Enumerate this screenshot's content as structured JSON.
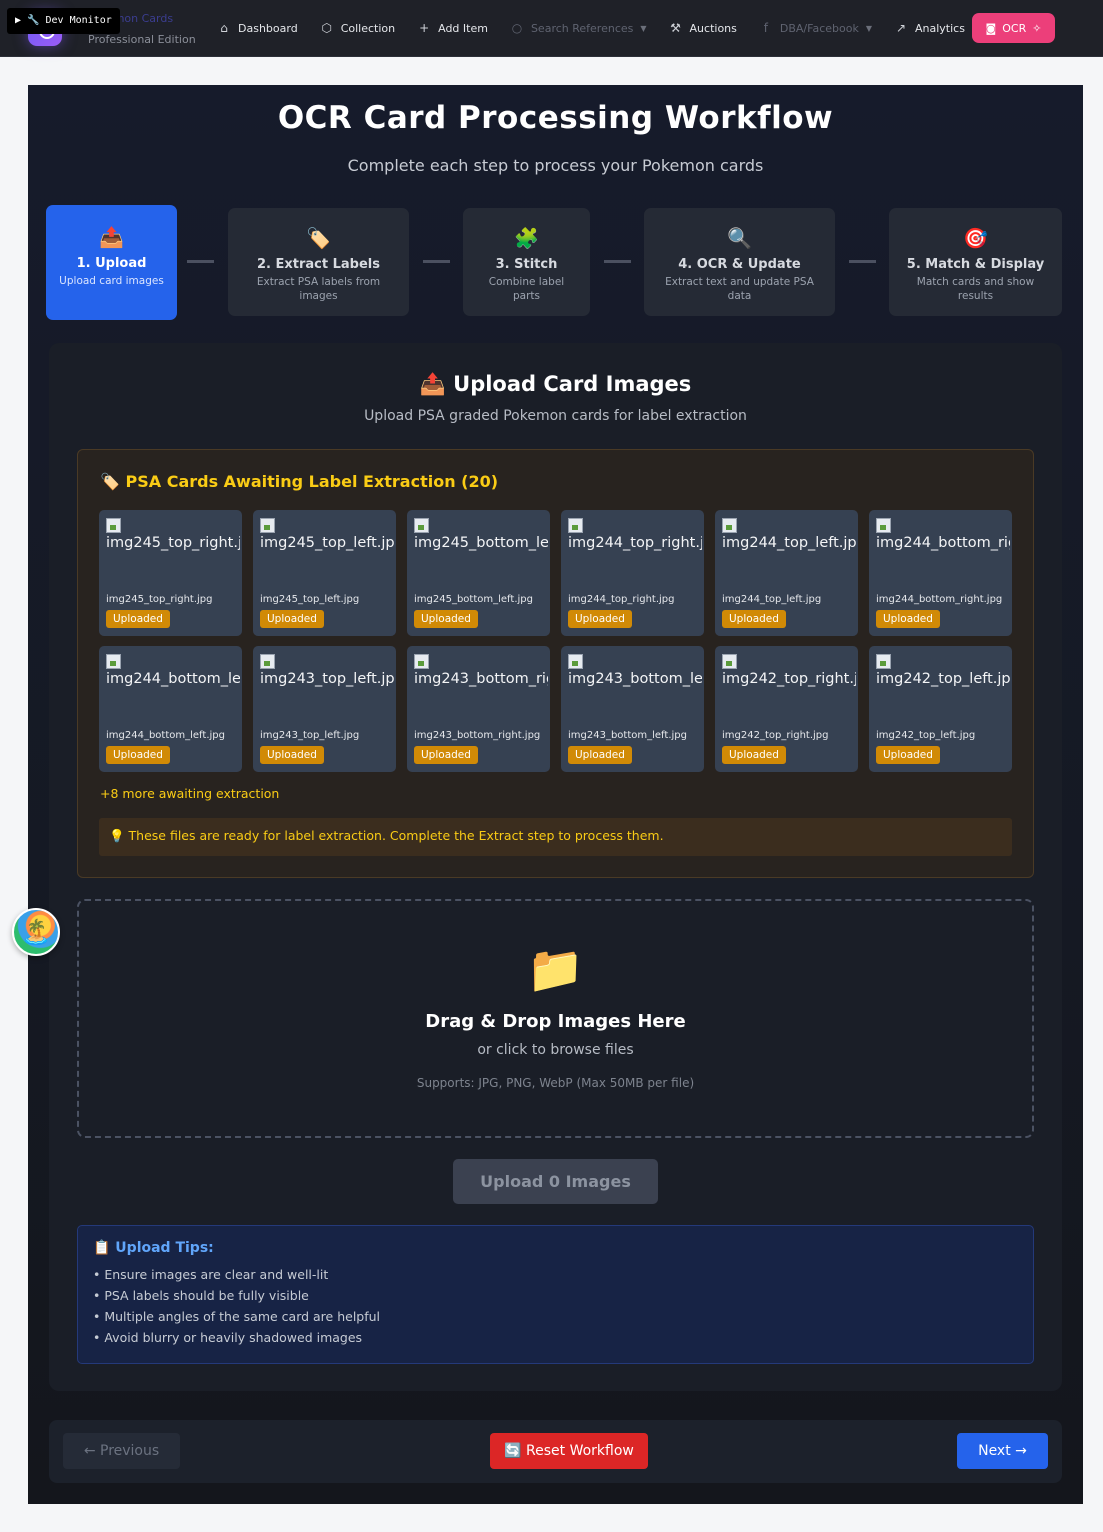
{
  "dev_monitor": "▶ 🔧 Dev Monitor",
  "brand": {
    "name": "Pokemon Cards",
    "edition": "Professional Edition"
  },
  "nav": {
    "items": [
      {
        "label": "Dashboard",
        "icon": "home-icon"
      },
      {
        "label": "Collection",
        "icon": "box-icon"
      },
      {
        "label": "Add Item",
        "icon": "plus-icon"
      },
      {
        "label": "Search References",
        "icon": "search-icon"
      },
      {
        "label": "Auctions",
        "icon": "gavel-icon"
      },
      {
        "label": "DBA/Facebook",
        "icon": "facebook-icon"
      },
      {
        "label": "Analytics",
        "icon": "trend-icon"
      }
    ],
    "ocr": "OCR"
  },
  "page": {
    "title": "OCR Card Processing Workflow",
    "subtitle": "Complete each step to process your Pokemon cards"
  },
  "steps": [
    {
      "icon": "📤",
      "title": "1. Upload",
      "desc": "Upload card images",
      "active": true
    },
    {
      "icon": "🏷️",
      "title": "2. Extract Labels",
      "desc": "Extract PSA labels from images",
      "active": false
    },
    {
      "icon": "🧩",
      "title": "3. Stitch",
      "desc": "Combine label parts",
      "active": false
    },
    {
      "icon": "🔍",
      "title": "4. OCR & Update",
      "desc": "Extract text and update PSA data",
      "active": false
    },
    {
      "icon": "🎯",
      "title": "5. Match & Display",
      "desc": "Match cards and show results",
      "active": false
    }
  ],
  "upload": {
    "title": "📤 Upload Card Images",
    "subtitle": "Upload PSA graded Pokemon cards for label extraction"
  },
  "awaiting": {
    "title": "🏷️ PSA Cards Awaiting Label Extraction (20)",
    "cards": [
      {
        "alt": "img245_top_right.jpg",
        "filename": "img245_top_right.jpg",
        "status": "Uploaded"
      },
      {
        "alt": "img245_top_left.jpg",
        "filename": "img245_top_left.jpg",
        "status": "Uploaded"
      },
      {
        "alt": "img245_bottom_left.jpg",
        "filename": "img245_bottom_left.jpg",
        "status": "Uploaded"
      },
      {
        "alt": "img244_top_right.jpg",
        "filename": "img244_top_right.jpg",
        "status": "Uploaded"
      },
      {
        "alt": "img244_top_left.jpg",
        "filename": "img244_top_left.jpg",
        "status": "Uploaded"
      },
      {
        "alt": "img244_bottom_right.jpg",
        "filename": "img244_bottom_right.jpg",
        "status": "Uploaded"
      },
      {
        "alt": "img244_bottom_left.jpg",
        "filename": "img244_bottom_left.jpg",
        "status": "Uploaded"
      },
      {
        "alt": "img243_top_left.jpg",
        "filename": "img243_top_left.jpg",
        "status": "Uploaded"
      },
      {
        "alt": "img243_bottom_right.jpg",
        "filename": "img243_bottom_right.jpg",
        "status": "Uploaded"
      },
      {
        "alt": "img243_bottom_left.jpg",
        "filename": "img243_bottom_left.jpg",
        "status": "Uploaded"
      },
      {
        "alt": "img242_top_right.jpg",
        "filename": "img242_top_right.jpg",
        "status": "Uploaded"
      },
      {
        "alt": "img242_top_left.jpg",
        "filename": "img242_top_left.jpg",
        "status": "Uploaded"
      }
    ],
    "more": "+8 more awaiting extraction",
    "notice": "💡 These files are ready for label extraction. Complete the Extract step to process them."
  },
  "dropzone": {
    "icon": "📁",
    "title": "Drag & Drop Images Here",
    "subtitle": "or click to browse files",
    "support": "Supports: JPG, PNG, WebP (Max 50MB per file)"
  },
  "upload_button": "Upload 0 Images",
  "tips": {
    "title": "📋 Upload Tips:",
    "items": [
      "• Ensure images are clear and well-lit",
      "• PSA labels should be fully visible",
      "• Multiple angles of the same card are helpful",
      "• Avoid blurry or heavily shadowed images"
    ]
  },
  "footer": {
    "previous": "← Previous",
    "reset": "🔄 Reset Workflow",
    "next": "Next →"
  },
  "floating_avatar": "🏝️",
  "colors": {
    "accent": "#2563eb",
    "ocr": "#ec3f7a",
    "warning": "#facc15",
    "badge": "#d18a06",
    "danger": "#dc2626"
  }
}
